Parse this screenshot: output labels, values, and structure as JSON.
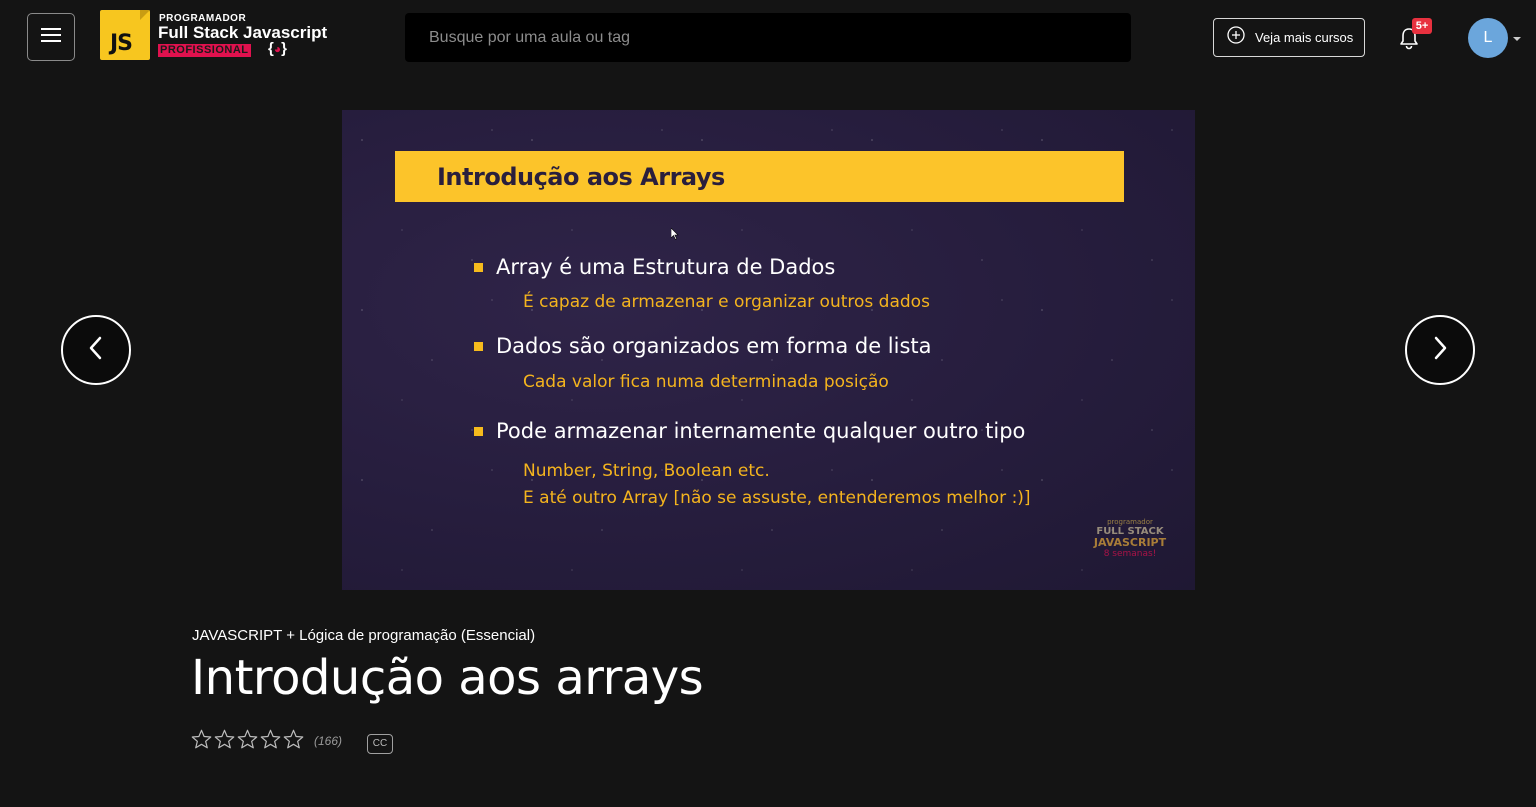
{
  "header": {
    "logo": {
      "badge": "JS",
      "small": "PROGRAMADOR",
      "big": "Full Stack Javascript",
      "pro": "PROFISSIONAL"
    },
    "search_placeholder": "Busque por uma aula ou tag",
    "courses_button": "Veja mais cursos",
    "notification_badge": "5+",
    "avatar_initial": "L"
  },
  "slide": {
    "title": "Introdução aos Arrays",
    "bullets": [
      {
        "text": "Array é uma Estrutura de Dados",
        "sub": [
          "É capaz de armazenar e organizar outros dados"
        ]
      },
      {
        "text": "Dados são organizados em forma de lista",
        "sub": [
          "Cada valor fica numa determinada posição"
        ]
      },
      {
        "text": "Pode armazenar internamente qualquer outro tipo",
        "sub": [
          "Number, String, Boolean etc.",
          "E até outro Array [não se assuste, entenderemos melhor :)]"
        ]
      }
    ],
    "watermark": [
      "programador",
      "FULL STACK",
      "JAVASCRIPT",
      "8 semanas!"
    ]
  },
  "lesson": {
    "course_name": "JAVASCRIPT + Lógica de programação (Essencial)",
    "title": "Introdução aos arrays",
    "rating_count": "(166)",
    "cc_label": "CC"
  },
  "colors": {
    "background": "#141414",
    "slide_title_bar": "#fcc42a",
    "slide_accent": "#f4b41e",
    "brand_pink": "#e0114e",
    "badge_red": "#e8313f",
    "avatar": "#6ba6dc"
  }
}
